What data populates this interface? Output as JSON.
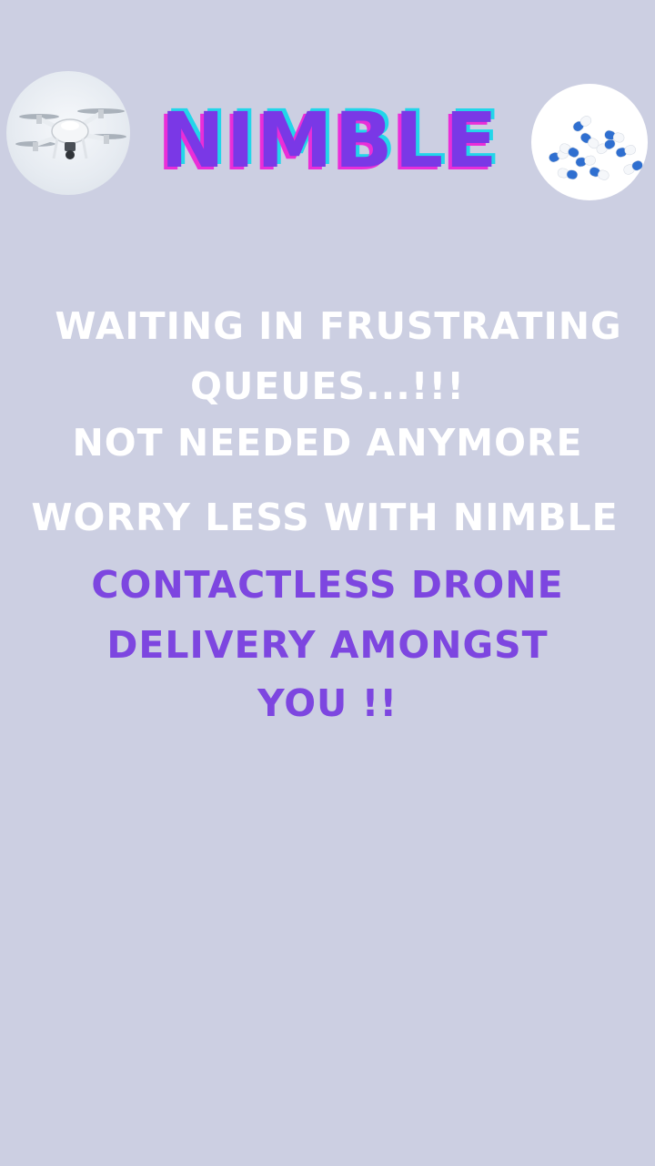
{
  "brand": {
    "name": "NIMBLE"
  },
  "images": {
    "left": "drone-icon",
    "right": "pills-icon"
  },
  "message": {
    "line1": "WAITING IN FRUSTRATING",
    "line2": "QUEUES...!!!",
    "line3": "NOT NEEDED ANYMORE",
    "tagline": "WORRY LESS WITH NIMBLE",
    "promo_line1": "CONTACTLESS DRONE",
    "promo_line2": "DELIVERY AMONGST",
    "promo_line3": "YOU !!"
  },
  "colors": {
    "background": "#cccfe2",
    "brand_fill": "#7a38e6",
    "brand_shadow_pink": "#ea2ed8",
    "brand_shadow_cyan": "#22d6ea",
    "text_white": "#ffffff",
    "text_purple": "#7d46e0"
  }
}
